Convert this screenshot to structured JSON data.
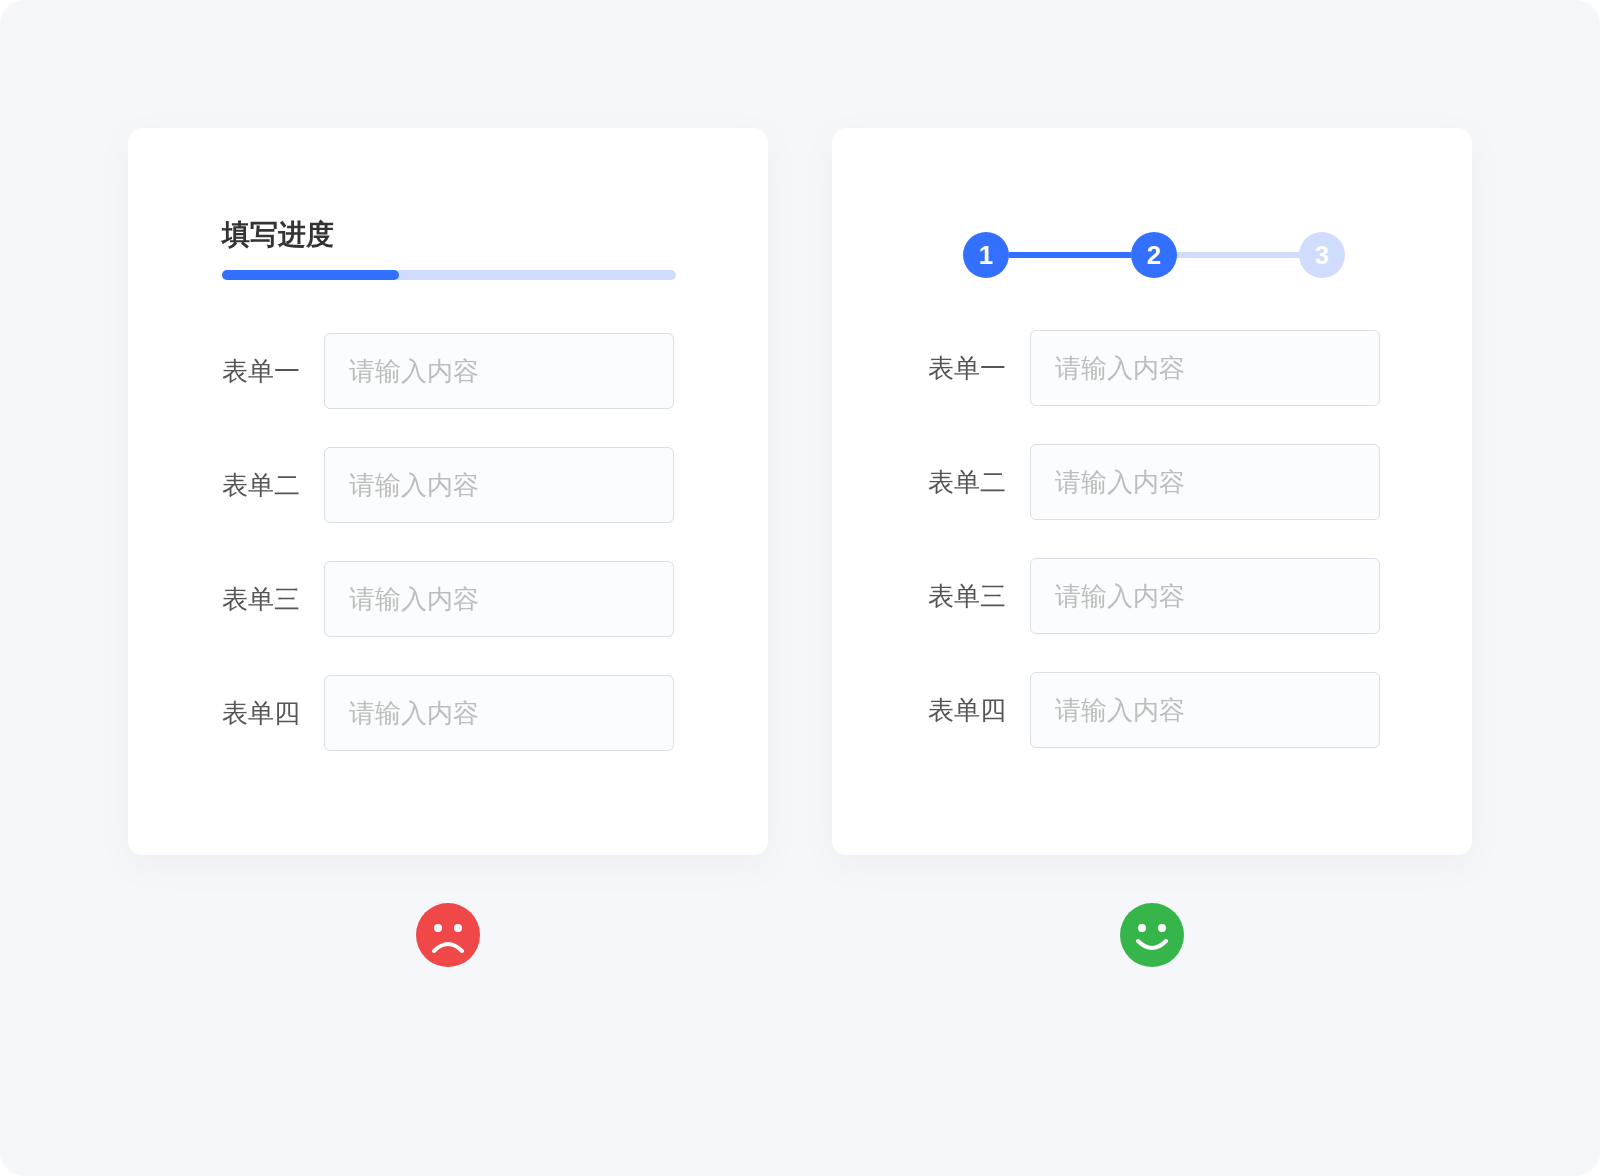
{
  "left_card": {
    "title": "填写进度",
    "progress": {
      "level": 0.39
    },
    "fields": [
      {
        "label": "表单一",
        "placeholder": "请输入内容"
      },
      {
        "label": "表单二",
        "placeholder": "请输入内容"
      },
      {
        "label": "表单三",
        "placeholder": "请输入内容"
      },
      {
        "label": "表单四",
        "placeholder": "请输入内容"
      }
    ],
    "verdict": {
      "kind": "sad"
    }
  },
  "right_card": {
    "steps": [
      {
        "label": "1",
        "active": true
      },
      {
        "label": "2",
        "active": true
      },
      {
        "label": "3",
        "active": false
      }
    ],
    "fields": [
      {
        "label": "表单一",
        "placeholder": "请输入内容"
      },
      {
        "label": "表单二",
        "placeholder": "请输入内容"
      },
      {
        "label": "表单三",
        "placeholder": "请输入内容"
      },
      {
        "label": "表单四",
        "placeholder": "请输入内容"
      }
    ],
    "verdict": {
      "kind": "happy"
    }
  }
}
